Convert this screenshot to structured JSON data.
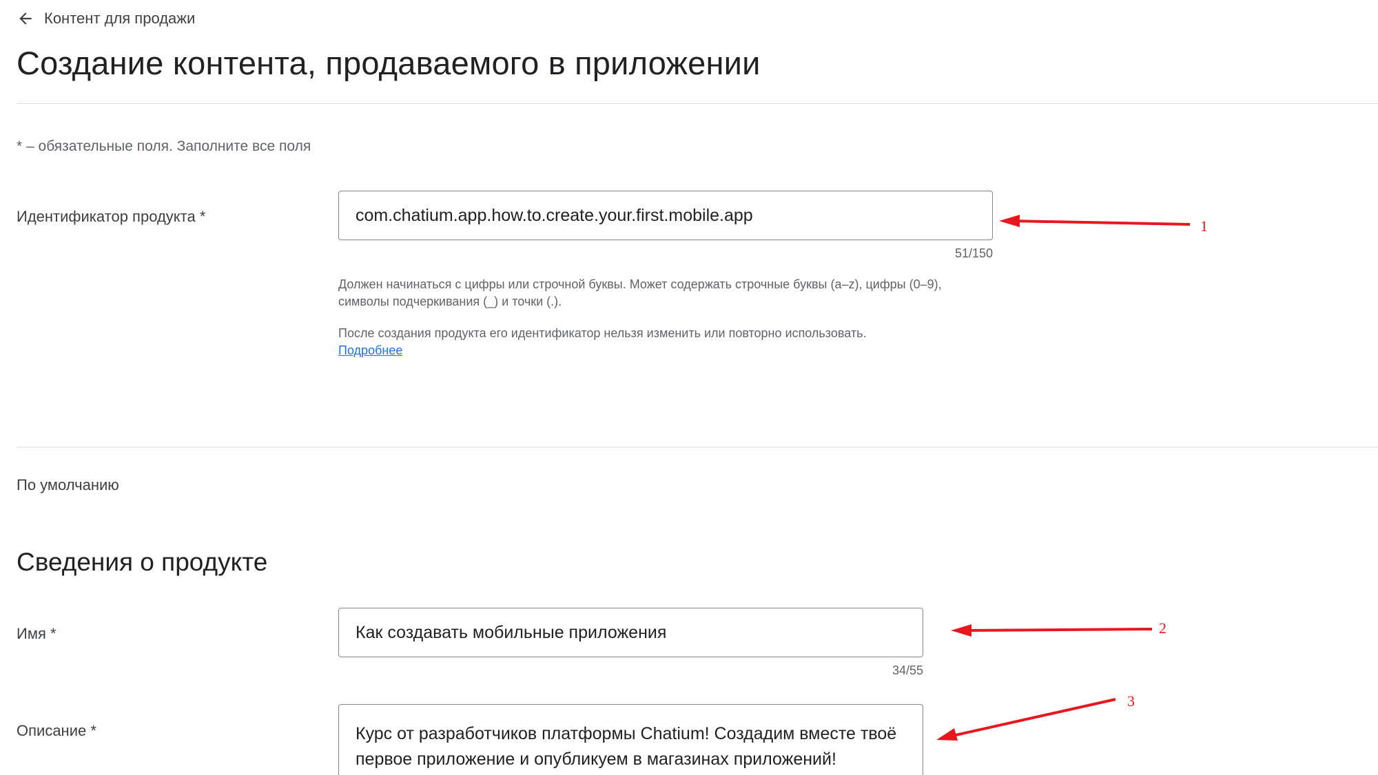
{
  "header": {
    "back_label": "Контент для продажи",
    "title": "Создание контента, продаваемого в приложении"
  },
  "required_note": "* – обязательные поля. Заполните все поля",
  "product_id": {
    "label": "Идентификатор продукта  *",
    "value": "com.chatium.app.how.to.create.your.first.mobile.app",
    "counter": "51/150",
    "help_line1": "Должен начинаться с цифры или строчной буквы. Может содержать строчные буквы (a–z), цифры (0–9), символы подчеркивания (_) и точки (.).",
    "help_line2": "После создания продукта его идентификатор нельзя изменить или повторно использовать.",
    "help_link": "Подробнее"
  },
  "default_section": "По умолчанию",
  "product_info": {
    "title": "Сведения о продукте",
    "name_label": "Имя  *",
    "name_value": "Как создавать мобильные приложения",
    "name_counter": "34/55",
    "description_label": "Описание  *",
    "description_value": "Курс от разработчиков платформы Chatium! Создадим вместе твоё первое приложение и опубликуем в магазинах приложений!"
  },
  "annotations": {
    "arrow_color": "#e8171d",
    "num1": "1",
    "num2": "2",
    "num3": "3"
  }
}
